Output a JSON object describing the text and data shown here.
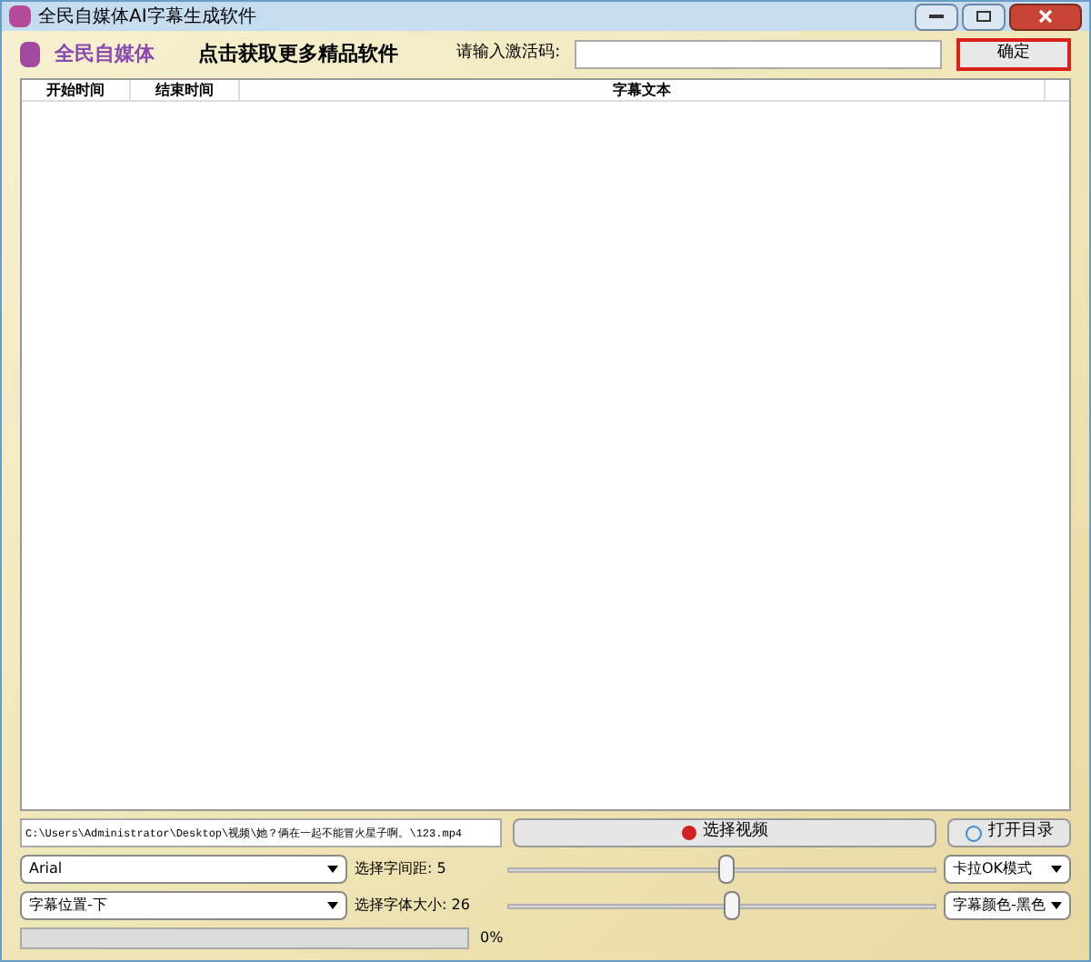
{
  "window": {
    "title": "全民自媒体AI字幕生成软件"
  },
  "header": {
    "brand": "全民自媒体",
    "promo_link": "点击获取更多精品软件",
    "code_label": "请输入激活码:",
    "confirm_button": "确定"
  },
  "table": {
    "columns": [
      "开始时间",
      "结束时间",
      "字幕文本"
    ]
  },
  "file_path": {
    "value": "C:\\Users\\Administrator\\Desktop\\视频\\她？俩在一起不能冒火星子啊。\\123.mp4"
  },
  "select_video_button": "选择视频",
  "open_folder_button": "打开目录",
  "font_select": {
    "value": "Arial"
  },
  "spacing": {
    "label": "选择字间距: 5",
    "level": 0.51
  },
  "mode_select": {
    "value": "卡拉OK模式"
  },
  "position_select": {
    "value": "字幕位置-下"
  },
  "font_size": {
    "label": "选择字体大小: 26",
    "level": 0.52
  },
  "color_select": {
    "value": "字幕颜色-黑色"
  },
  "progress": {
    "level": 0,
    "reading": "0%"
  }
}
